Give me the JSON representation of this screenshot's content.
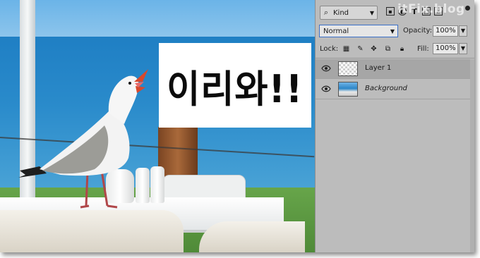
{
  "canvas": {
    "overlay_text": "이리와!!"
  },
  "layers_panel": {
    "filter": {
      "icon": "search-icon",
      "label": "Kind"
    },
    "filter_icons": [
      "image-filter-icon",
      "adjustment-filter-icon",
      "type-filter-icon",
      "shape-filter-icon",
      "smart-object-filter-icon"
    ],
    "blend_mode": "Normal",
    "opacity_label": "Opacity:",
    "opacity_value": "100%",
    "lock_label": "Lock:",
    "fill_label": "Fill:",
    "fill_value": "100%",
    "layers": [
      {
        "name": "Layer 1",
        "selected": true,
        "thumb": "transparent"
      },
      {
        "name": "Background",
        "selected": false,
        "thumb": "photo"
      }
    ]
  },
  "watermark": "itFix.blog"
}
